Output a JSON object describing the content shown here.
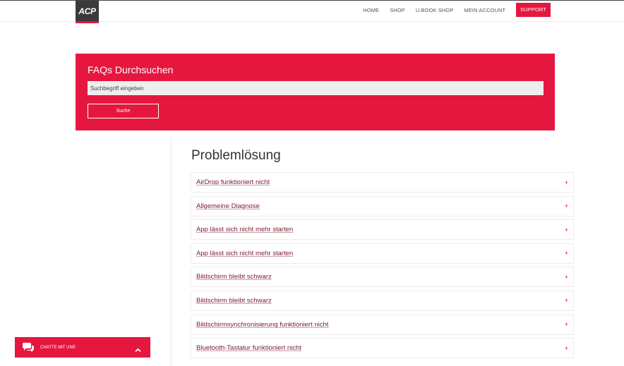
{
  "header": {
    "logo_text": "ACP",
    "nav": [
      {
        "label": "HOME"
      },
      {
        "label": "SHOP"
      },
      {
        "label": "U.BOOK SHOP"
      },
      {
        "label": "MEIN ACCOUNT"
      },
      {
        "label": "SUPPORT"
      }
    ]
  },
  "search": {
    "title": "FAQs Durchsuchen",
    "placeholder": "Suchbegriff eingeben",
    "button_label": "Suche"
  },
  "section": {
    "title": "Problemlösung",
    "items": [
      {
        "label": "AirDrop funktioniert nicht"
      },
      {
        "label": "Allgemeine Diagnose"
      },
      {
        "label": "App lässt sich nicht mehr starten"
      },
      {
        "label": "App lässt sich nicht mehr starten"
      },
      {
        "label": "Bildschirm bleibt schwarz"
      },
      {
        "label": "Bildschirm bleibt schwarz"
      },
      {
        "label": "Bildschirmsynchronisierung funktioniert nicht"
      },
      {
        "label": "Bluetooth-Tastatur funktioniert nicht"
      }
    ],
    "expand_symbol": "+"
  },
  "chat": {
    "label": "CHATTE MIT UNS"
  },
  "colors": {
    "accent": "#e5173f",
    "logo_bg": "#3a3a3a"
  }
}
